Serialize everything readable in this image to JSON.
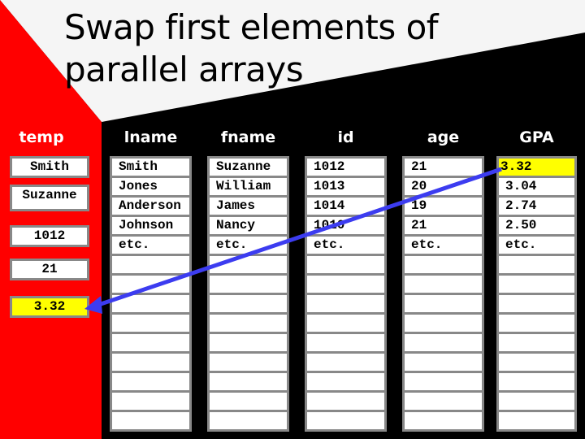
{
  "slide": {
    "title": "Swap first elements of parallel arrays",
    "colors": {
      "red_region": "#ff0000",
      "title_background": "#f5f5f5",
      "dark_background": "#000000",
      "cell_border": "#888888",
      "highlight": "#ffff00",
      "arrow": "#3c3cf0"
    }
  },
  "temp": {
    "header": "temp",
    "values": [
      "Smith",
      "Suzanne",
      "1012",
      "21",
      "3.32"
    ],
    "highlighted_index": 4
  },
  "arrays": [
    {
      "header": "lname",
      "values": [
        "Smith",
        "Jones",
        "Anderson",
        "Johnson",
        "etc.",
        "",
        "",
        "",
        "",
        "",
        "",
        "",
        "",
        ""
      ]
    },
    {
      "header": "fname",
      "values": [
        "Suzanne",
        "William",
        "James",
        "Nancy",
        "etc.",
        "",
        "",
        "",
        "",
        "",
        "",
        "",
        "",
        ""
      ]
    },
    {
      "header": "id",
      "values": [
        "1012",
        "1013",
        "1014",
        "1010",
        "etc.",
        "",
        "",
        "",
        "",
        "",
        "",
        "",
        "",
        ""
      ]
    },
    {
      "header": "age",
      "values": [
        "21",
        "20",
        "19",
        "21",
        "etc.",
        "",
        "",
        "",
        "",
        "",
        "",
        "",
        "",
        ""
      ]
    },
    {
      "header": "GPA",
      "values": [
        "3.32",
        "3.04",
        "2.74",
        "2.50",
        "etc.",
        "",
        "",
        "",
        "",
        "",
        "",
        "",
        "",
        ""
      ],
      "highlighted_index": 0
    }
  ],
  "arrow": {
    "from": "GPA[0]",
    "to": "temp GPA box",
    "meaning": "copy GPA[0] value into temp"
  }
}
